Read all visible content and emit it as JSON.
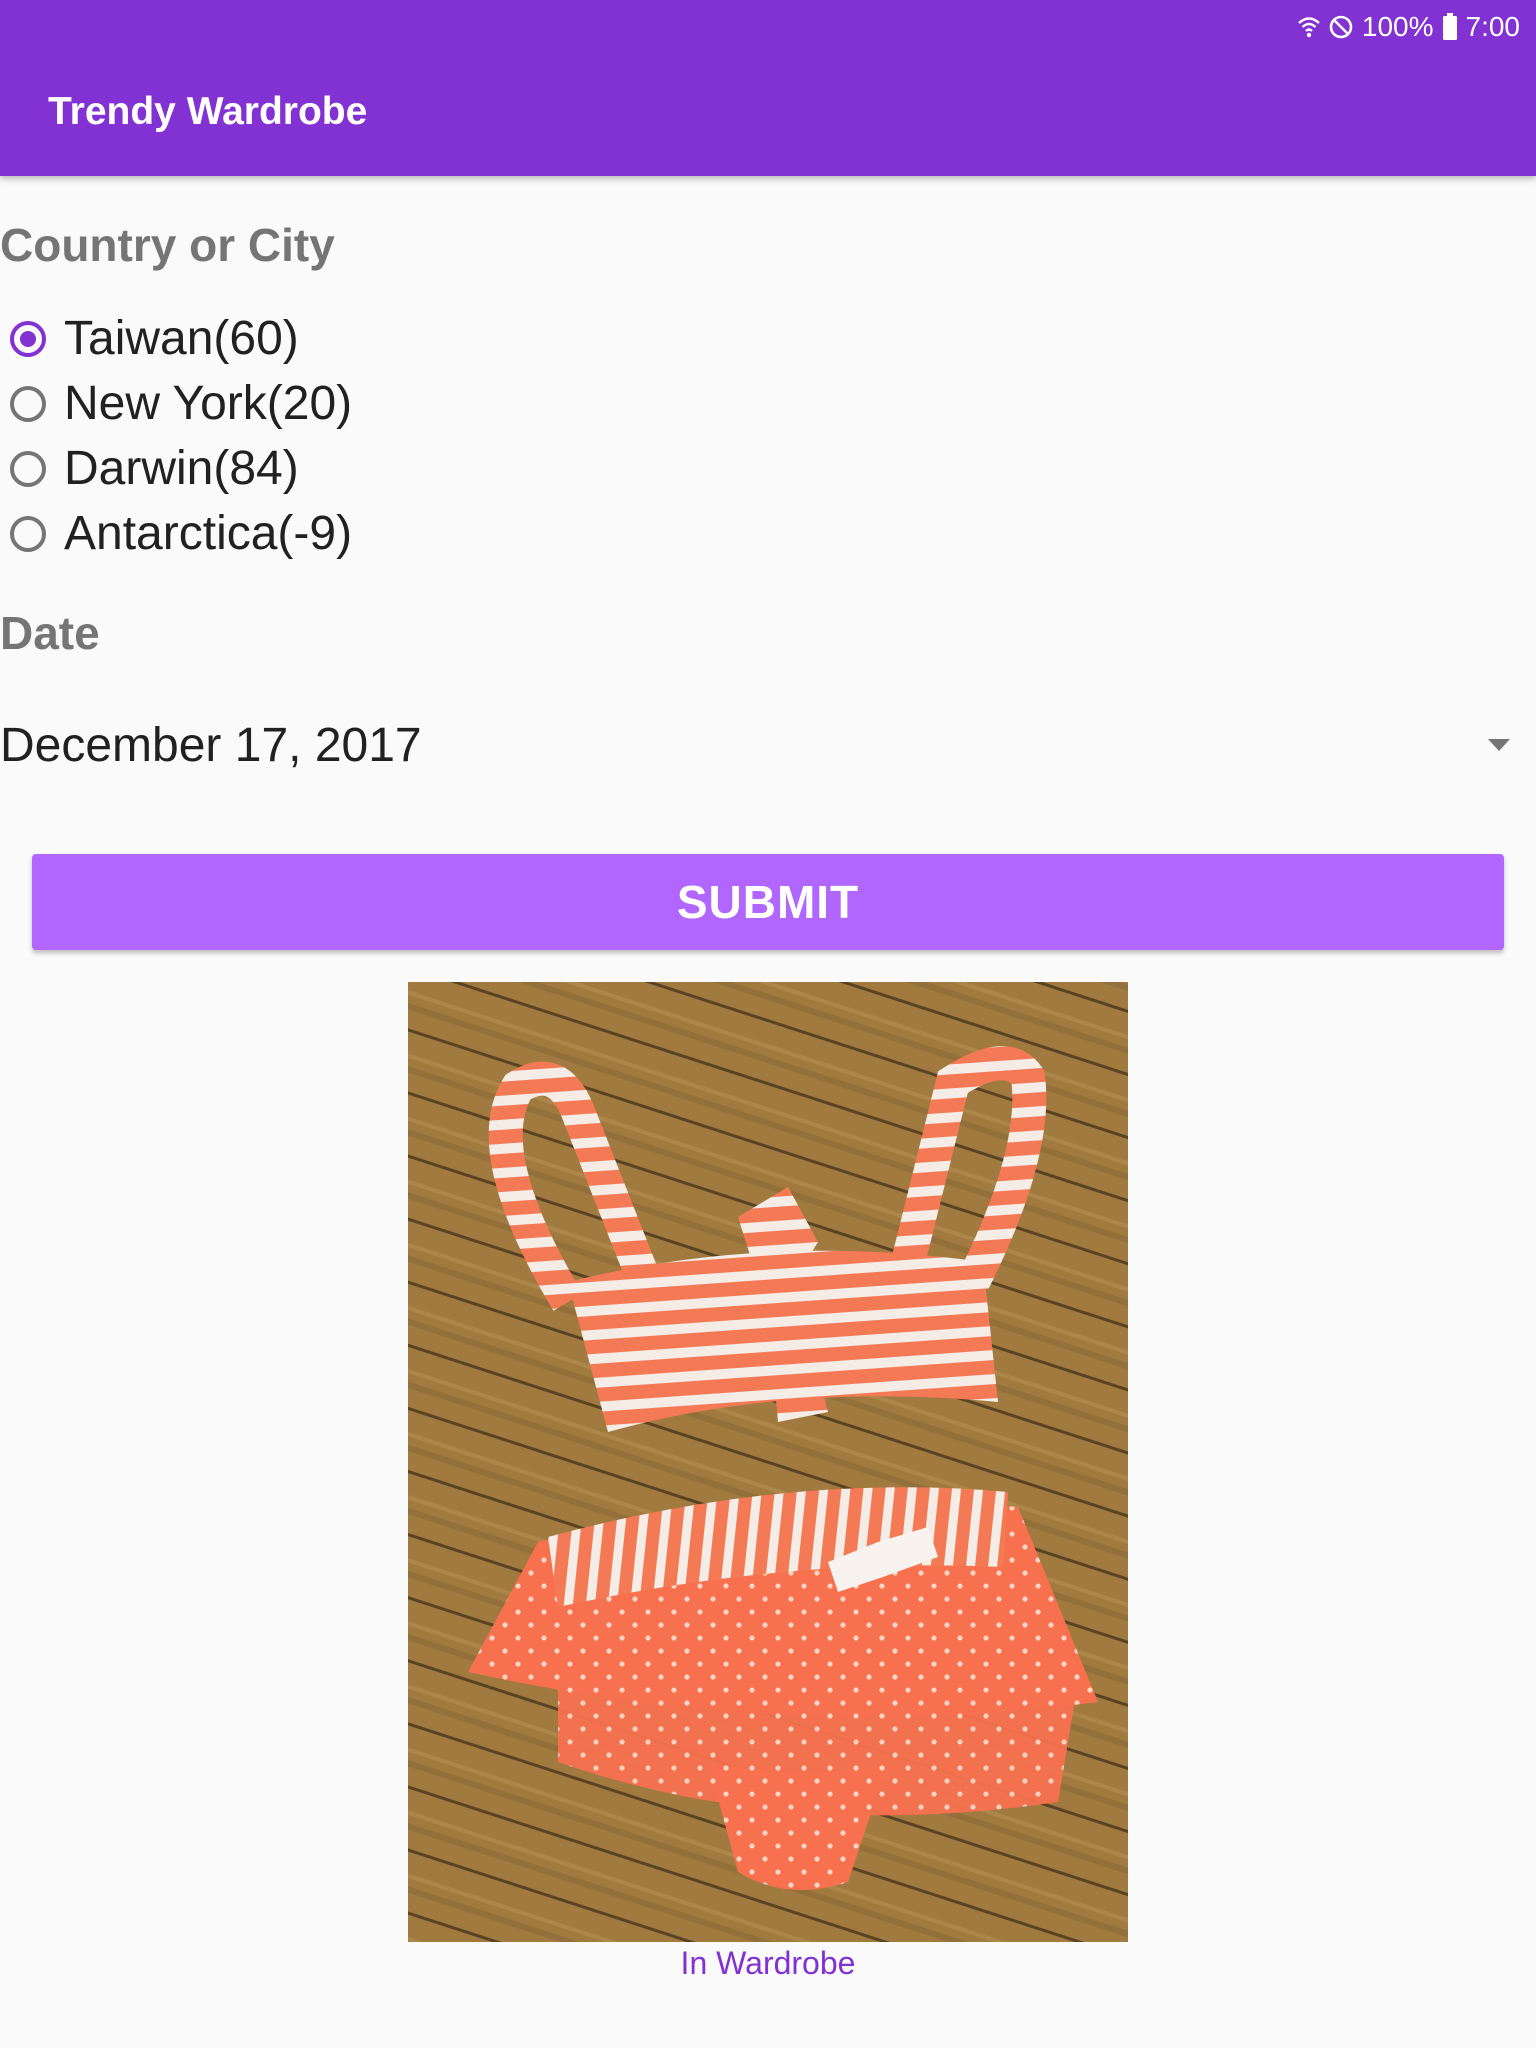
{
  "status_bar": {
    "battery": "100%",
    "time": "7:00"
  },
  "app_bar": {
    "title": "Trendy Wardrobe"
  },
  "location": {
    "label": "Country or City",
    "options": [
      {
        "label": "Taiwan(60)",
        "selected": true
      },
      {
        "label": "New York(20)",
        "selected": false
      },
      {
        "label": "Darwin(84)",
        "selected": false
      },
      {
        "label": "Antarctica(-9)",
        "selected": false
      }
    ]
  },
  "date": {
    "label": "Date",
    "value": "December 17, 2017"
  },
  "submit": {
    "label": "SUBMIT"
  },
  "result": {
    "caption": "In Wardrobe"
  },
  "colors": {
    "primary": "#8231d3",
    "accent": "#b066ff",
    "background": "#fafafa"
  },
  "icons": [
    "wifi-icon",
    "do-not-disturb-icon",
    "battery-icon",
    "dropdown-arrow-icon"
  ]
}
